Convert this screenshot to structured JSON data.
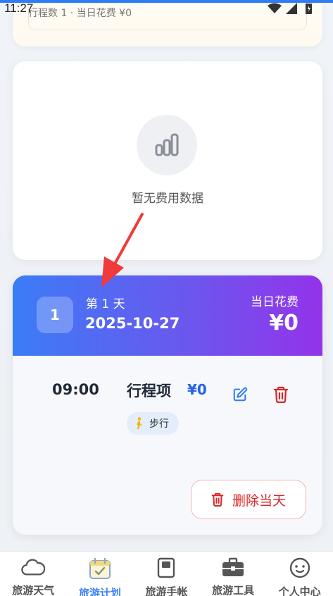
{
  "status_bar": {
    "time": "11:27"
  },
  "summary": {
    "text": "行程数 1 · 当日花费 ¥0"
  },
  "empty_expense": {
    "text": "暂无费用数据"
  },
  "day": {
    "number": "1",
    "label": "第 1 天",
    "date": "2025-10-27",
    "spend_label": "当日花费",
    "spend_value": "¥0"
  },
  "itinerary_item": {
    "time": "09:00",
    "title": "行程项",
    "cost": "¥0",
    "transport": "步行"
  },
  "delete_day_label": "删除当天",
  "bottom_nav": [
    {
      "label": "旅游天气",
      "icon": "cloud-icon",
      "active": false
    },
    {
      "label": "旅游计划",
      "icon": "calendar-check-icon",
      "active": true
    },
    {
      "label": "旅游手帐",
      "icon": "book-icon",
      "active": false
    },
    {
      "label": "旅游工具",
      "icon": "toolbox-icon",
      "active": false
    },
    {
      "label": "个人中心",
      "icon": "smiley-icon",
      "active": false
    }
  ],
  "colors": {
    "accent": "#3b82f6",
    "header_gradient_start": "#3b7cf6",
    "header_gradient_end": "#9333ea",
    "danger": "#dc2626",
    "cost_blue": "#2563eb"
  }
}
